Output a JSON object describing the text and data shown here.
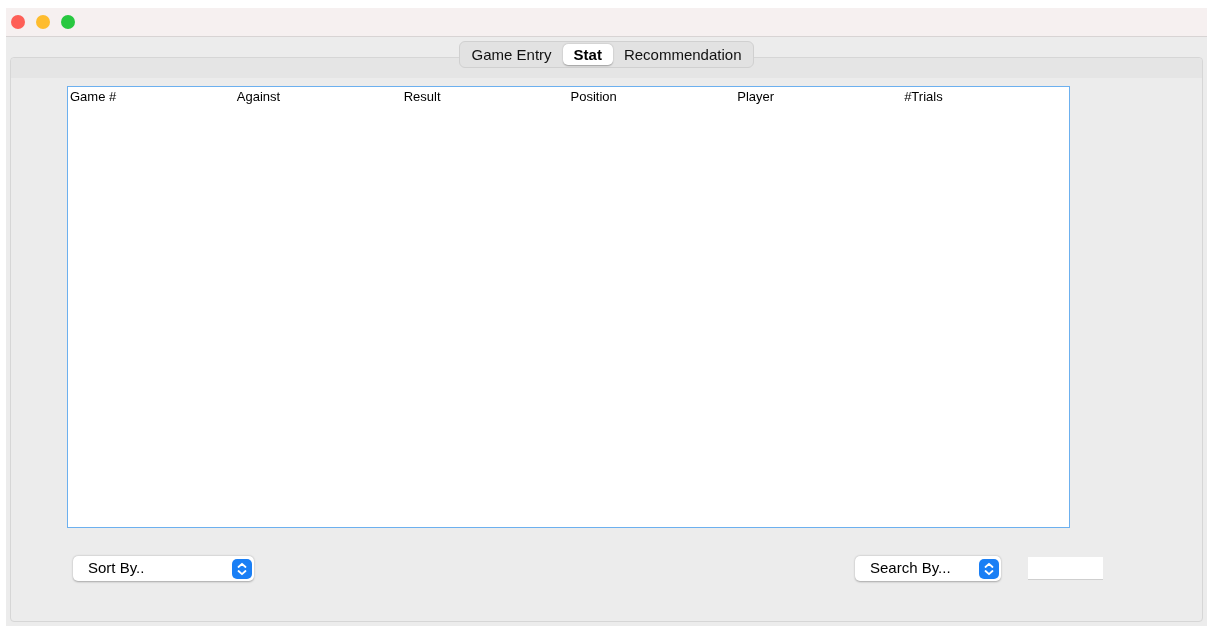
{
  "tabs": [
    {
      "label": "Game Entry",
      "selected": false
    },
    {
      "label": "Stat",
      "selected": true
    },
    {
      "label": "Recommendation",
      "selected": false
    }
  ],
  "table": {
    "columns": [
      "Game #",
      "Against",
      "Result",
      "Position",
      "Player",
      "#Trials"
    ]
  },
  "sort_select": {
    "value": "Sort By.."
  },
  "search_select": {
    "value": "Search By..."
  }
}
